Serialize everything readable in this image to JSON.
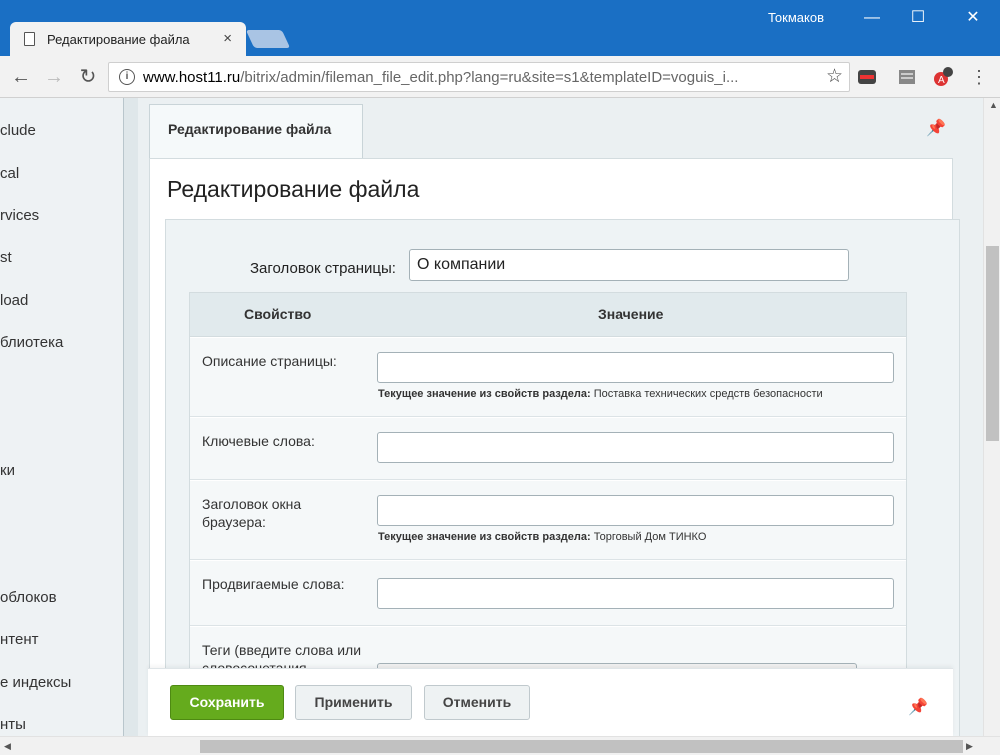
{
  "browser": {
    "tab_title": "Редактирование файла",
    "tab_close": "×",
    "user": "Токмаков",
    "window_controls": [
      "—",
      "☐",
      "✕"
    ],
    "url_host": "www.host11.ru",
    "url_path": "/bitrix/admin/fileman_file_edit.php?lang=ru&site=s1&templateID=voguis_i..."
  },
  "sidebar": {
    "items": [
      {
        "label": "clude"
      },
      {
        "label": "cal"
      },
      {
        "label": "rvices"
      },
      {
        "label": "st"
      },
      {
        "label": "load"
      },
      {
        "label": "блиотека"
      },
      {
        "label": "ки"
      },
      {
        "label": "облоков"
      },
      {
        "label": "нтент"
      },
      {
        "label": "е индексы"
      },
      {
        "label": "нты"
      }
    ]
  },
  "page": {
    "tab_label": "Редактирование файла",
    "title": "Редактирование файла",
    "header_label": "Заголовок страницы:",
    "header_value": "О компании"
  },
  "props": {
    "col_property": "Свойство",
    "col_value": "Значение",
    "hint_prefix": "Текущее значение из свойств раздела:",
    "rows": [
      {
        "label": "Описание страницы:",
        "value": "",
        "hint": "Поставка технических средств безопасности"
      },
      {
        "label": "Ключевые слова:",
        "value": ""
      },
      {
        "label": "Заголовок окна браузера:",
        "value": "",
        "hint": "Торговый Дом ТИНКО"
      },
      {
        "label": "Продвигаемые слова:",
        "value": ""
      },
      {
        "label": "Теги (введите слова или словосочетания",
        "value": ""
      }
    ]
  },
  "footer": {
    "save": "Сохранить",
    "apply": "Применить",
    "cancel": "Отменить"
  },
  "colors": {
    "titlebar": "#1a6fc4",
    "save_button": "#65ab1d"
  }
}
